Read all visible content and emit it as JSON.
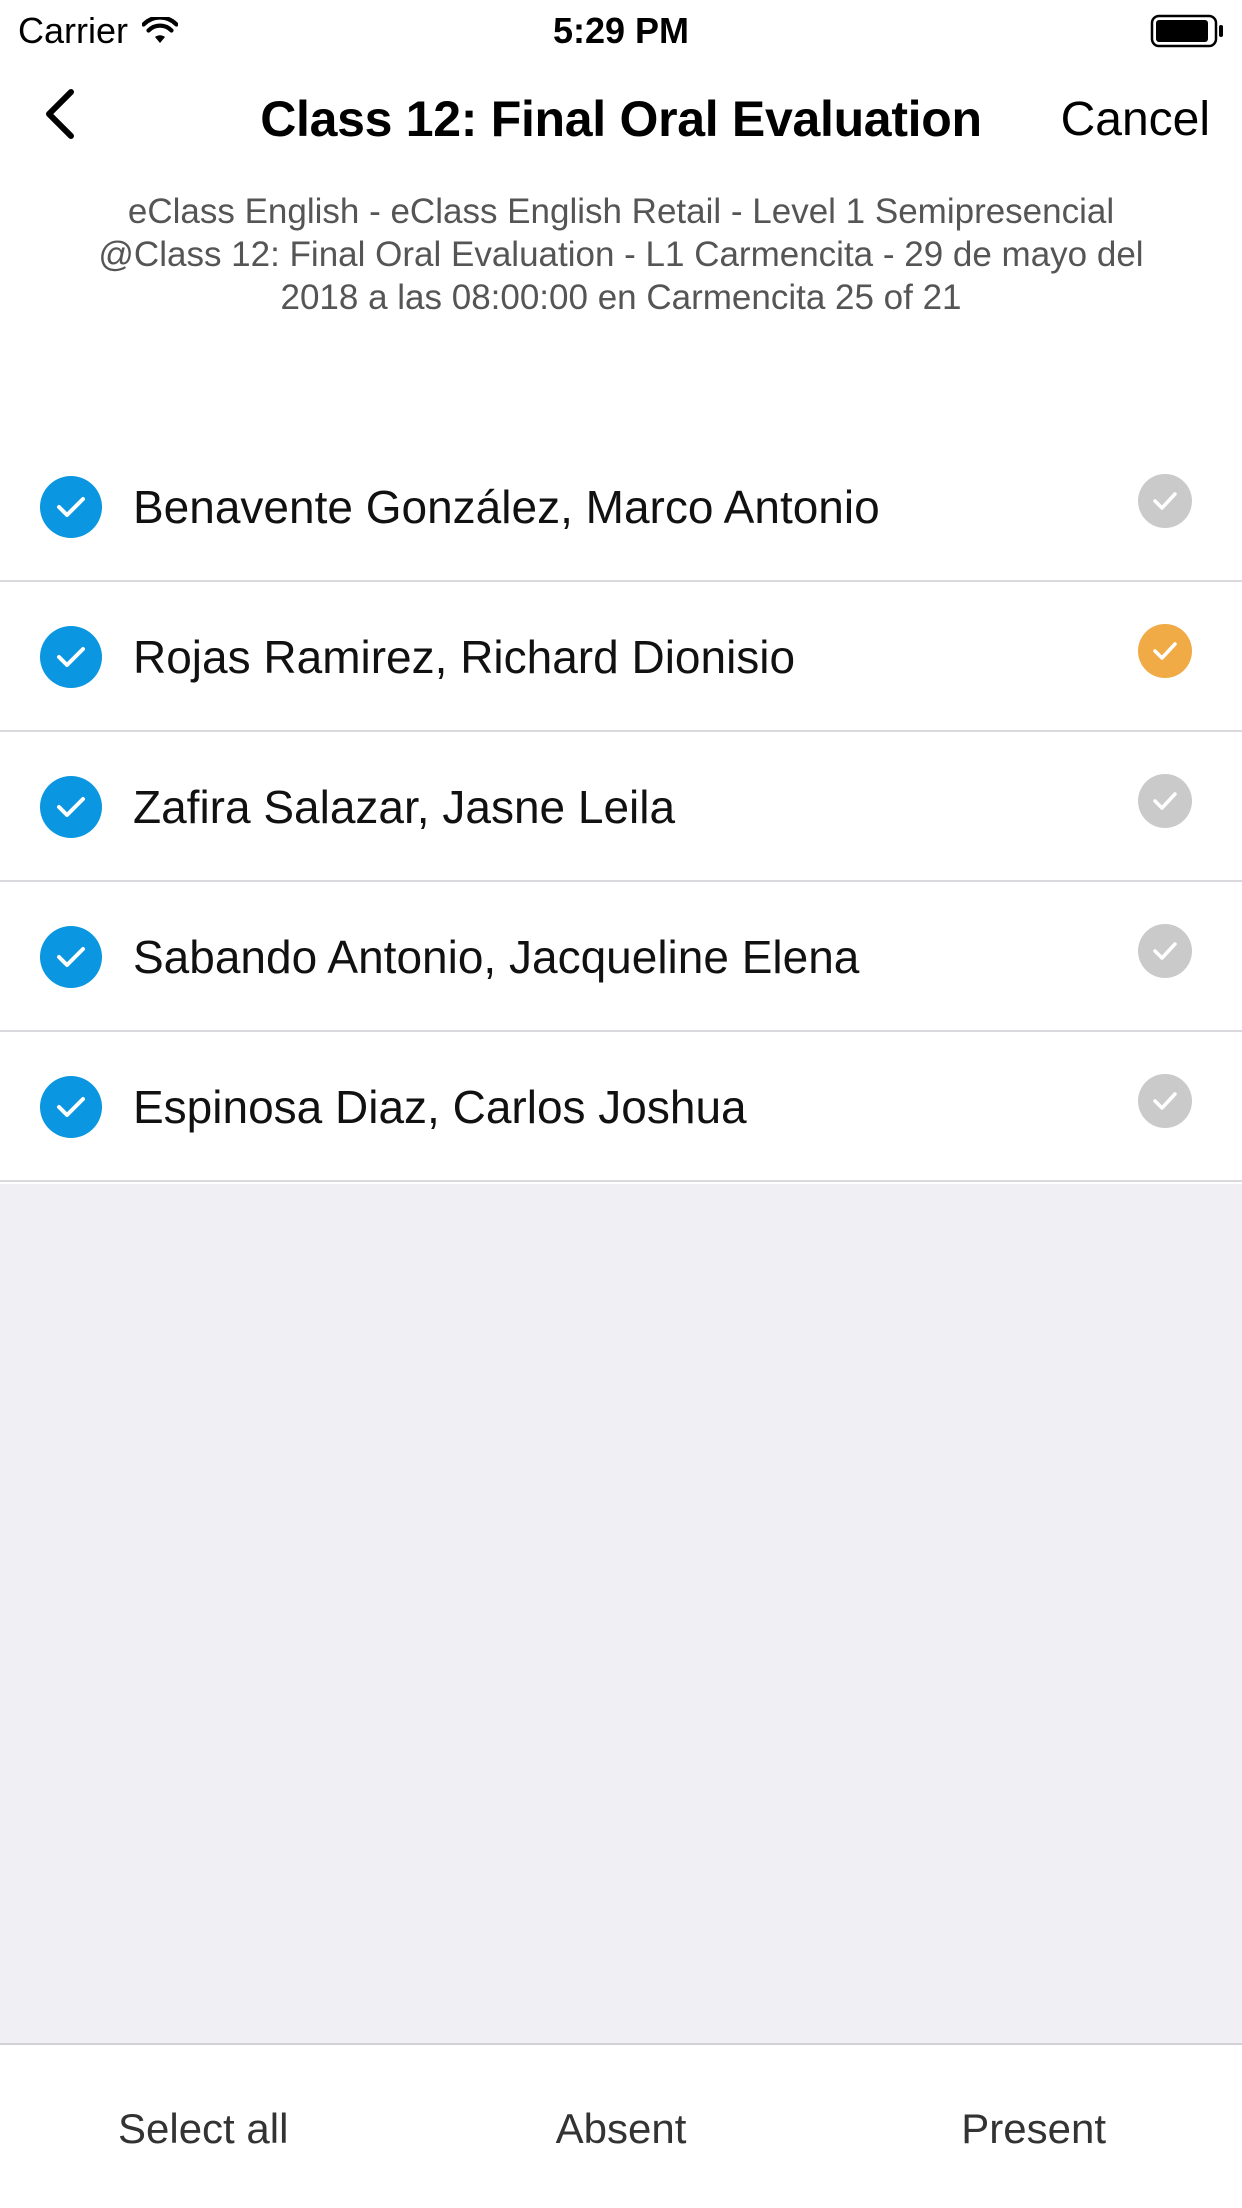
{
  "status_bar": {
    "carrier": "Carrier",
    "time": "5:29 PM",
    "wifi_icon": "wifi-icon",
    "battery_icon": "battery-icon"
  },
  "nav": {
    "back_icon": "chevron-left-icon",
    "title": "Class 12: Final Oral Evaluation",
    "cancel_label": "Cancel"
  },
  "subtitle": {
    "line1": "eClass English - eClass English Retail -  Level 1 Semipresencial",
    "line2": "@Class 12: Final Oral Evaluation - L1 Carmencita - 29 de mayo del",
    "line3": "2018 a las 08:00:00 en Carmencita 25 of 21"
  },
  "students": [
    {
      "name": "Benavente González, Marco Antonio",
      "selected": true,
      "status": "unmarked"
    },
    {
      "name": "Rojas Ramirez, Richard Dionisio",
      "selected": true,
      "status": "marked"
    },
    {
      "name": "Zafira Salazar, Jasne Leila",
      "selected": true,
      "status": "unmarked"
    },
    {
      "name": "Sabando Antonio, Jacqueline Elena",
      "selected": true,
      "status": "unmarked"
    },
    {
      "name": "Espinosa Diaz, Carlos Joshua",
      "selected": true,
      "status": "unmarked"
    }
  ],
  "toolbar": {
    "select_all_label": "Select all",
    "absent_label": "Absent",
    "present_label": "Present"
  },
  "colors": {
    "selected_check": "#0a96e0",
    "status_marked": "#f0ab46",
    "status_unmarked": "#cacaca",
    "empty_background": "#efeff4"
  }
}
